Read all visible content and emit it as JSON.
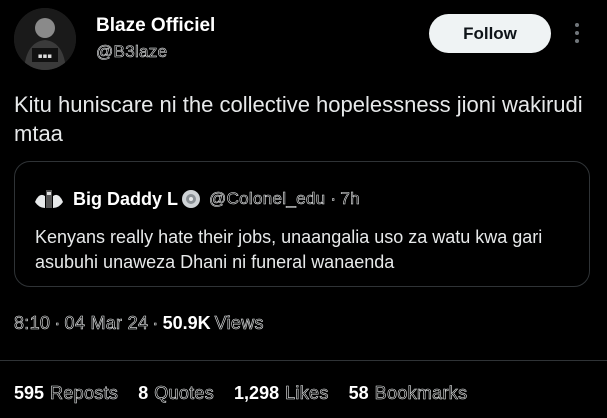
{
  "author": {
    "display_name": "Blaze Officiel",
    "handle": "@B3laze",
    "follow_label": "Follow"
  },
  "tweet": {
    "text": "Kitu huniscare ni the collective hopelessness jioni wakirudi mtaa"
  },
  "quote": {
    "name": "Big Daddy L",
    "handle": "@Colonel_edu",
    "separator": "·",
    "time": "7h",
    "text": "Kenyans  really hate their jobs, unaangalia uso za watu kwa gari asubuhi unaweza Dhani ni funeral wanaenda"
  },
  "meta": {
    "time": "8:10",
    "sep1": "·",
    "date": "04 Mar 24",
    "sep2": "·",
    "views_count": "50.9K",
    "views_label": "Views"
  },
  "stats": [
    {
      "count": "595",
      "label": "Reposts"
    },
    {
      "count": "8",
      "label": "Quotes"
    },
    {
      "count": "1,298",
      "label": "Likes"
    },
    {
      "count": "58",
      "label": "Bookmarks"
    }
  ],
  "icons": {
    "more": "more-vertical-icon",
    "verified": "verified-badge-icon"
  },
  "colors": {
    "background": "#000000",
    "text": "#e7e9ea",
    "follow_bg": "#eff3f4",
    "border": "#2f3336"
  }
}
